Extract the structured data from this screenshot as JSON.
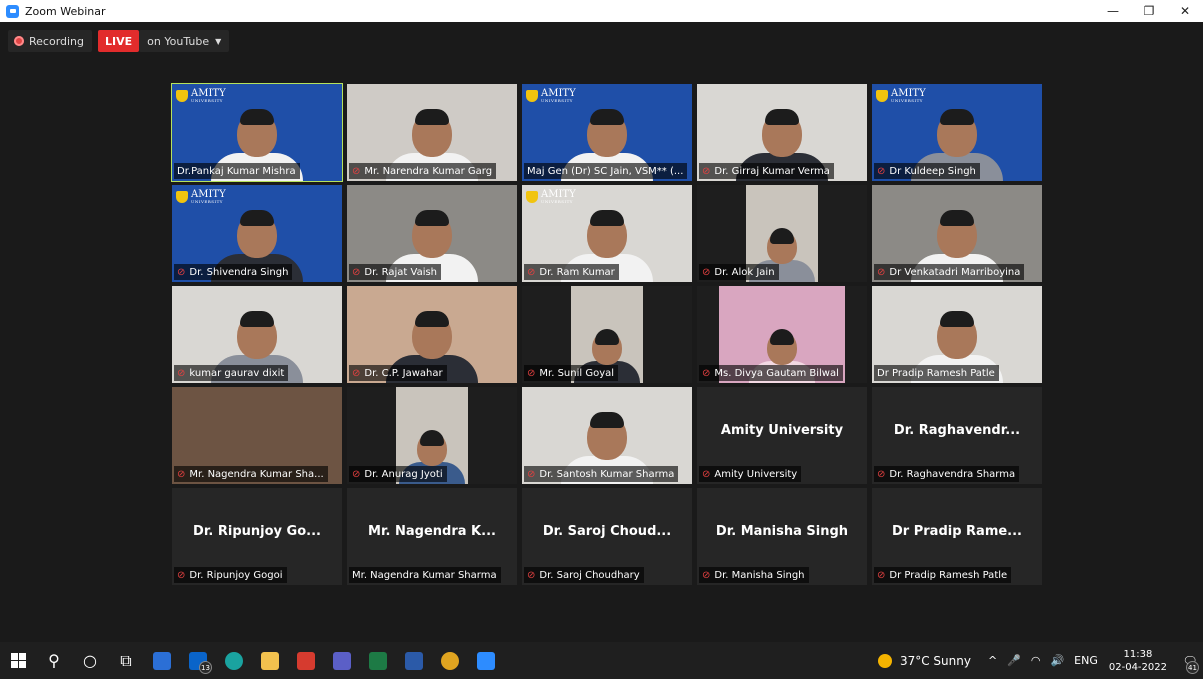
{
  "window": {
    "title": "Zoom Webinar"
  },
  "recbar": {
    "recording": "Recording",
    "live": "LIVE",
    "on_youtube": "on YouTube"
  },
  "tiles": [
    {
      "label": "Dr.Pankaj Kumar Mishra",
      "muted": false,
      "type": "video",
      "bg": "blue",
      "logo": true,
      "active": true,
      "body": "white"
    },
    {
      "label": "Mr.  Narendra Kumar Garg",
      "muted": true,
      "type": "video",
      "bg": "wall",
      "logo": false,
      "body": "white"
    },
    {
      "label": "Maj Gen (Dr) SC Jain, VSM** (...",
      "muted": false,
      "type": "video",
      "bg": "blue",
      "logo": true,
      "body": "white"
    },
    {
      "label": "Dr. Girraj Kumar Verma",
      "muted": true,
      "type": "video",
      "bg": "light",
      "logo": false,
      "body": "suit"
    },
    {
      "label": "Dr Kuldeep Singh",
      "muted": true,
      "type": "video",
      "bg": "blue",
      "logo": true,
      "body": "grey"
    },
    {
      "label": "Dr.  Shivendra Singh",
      "muted": true,
      "type": "video",
      "bg": "blue",
      "logo": true,
      "body": "suit"
    },
    {
      "label": "Dr. Rajat Vaish",
      "muted": true,
      "type": "video",
      "bg": "gray",
      "logo": false,
      "body": "white"
    },
    {
      "label": "Dr. Ram Kumar",
      "muted": true,
      "type": "video",
      "bg": "light",
      "logo": true,
      "body": "white"
    },
    {
      "label": "Dr. Alok Jain",
      "muted": true,
      "type": "inset",
      "bg": "dark",
      "body": "grey"
    },
    {
      "label": "Dr Venkatadri Marriboyina",
      "muted": true,
      "type": "video",
      "bg": "gray",
      "logo": false,
      "body": "white"
    },
    {
      "label": "kumar gaurav dixit",
      "muted": true,
      "type": "video",
      "bg": "light",
      "logo": false,
      "body": "grey"
    },
    {
      "label": "Dr. C.P. Jawahar",
      "muted": true,
      "type": "video",
      "bg": "warm",
      "logo": false,
      "body": "suit"
    },
    {
      "label": "Mr.  Sunil Goyal",
      "muted": true,
      "type": "inset",
      "bg": "dark",
      "body": "suit"
    },
    {
      "label": "Ms. Divya Gautam Bilwal",
      "muted": true,
      "type": "inset",
      "bg": "dark",
      "body": "pink"
    },
    {
      "label": "Dr Pradip Ramesh Patle",
      "muted": false,
      "type": "video",
      "bg": "light",
      "logo": false,
      "body": "white"
    },
    {
      "label": "Mr.  Nagendra Kumar Sha...",
      "muted": true,
      "type": "video",
      "bg": "brown",
      "logo": false,
      "body": "none"
    },
    {
      "label": "Dr.  Anurag Jyoti",
      "muted": true,
      "type": "inset",
      "bg": "dark",
      "body": "blue"
    },
    {
      "label": "Dr. Santosh Kumar Sharma",
      "muted": true,
      "type": "video",
      "bg": "light",
      "logo": false,
      "body": "white"
    },
    {
      "label": "Amity University",
      "muted": true,
      "type": "name",
      "name": "Amity University"
    },
    {
      "label": "Dr. Raghavendra Sharma",
      "muted": true,
      "type": "name",
      "name": "Dr.  Raghavendr..."
    },
    {
      "label": "Dr.  Ripunjoy Gogoi",
      "muted": true,
      "type": "name",
      "name": "Dr.  Ripunjoy Go..."
    },
    {
      "label": "Mr.  Nagendra Kumar Sharma",
      "muted": false,
      "type": "name",
      "name": "Mr.  Nagendra K..."
    },
    {
      "label": "Dr.  Saroj Choudhary",
      "muted": true,
      "type": "name",
      "name": "Dr.  Saroj Choud..."
    },
    {
      "label": "Dr. Manisha Singh",
      "muted": true,
      "type": "name",
      "name": "Dr. Manisha Singh"
    },
    {
      "label": "Dr Pradip Ramesh Patle",
      "muted": true,
      "type": "name",
      "name": "Dr Pradip Rame..."
    }
  ],
  "logo_text": "AMITY",
  "logo_sub": "UNIVERSITY",
  "taskbar": {
    "apps": [
      {
        "name": "start-button",
        "glyph": "windows-logo"
      },
      {
        "name": "search-button",
        "glyph": "search-icon",
        "text": "⚲"
      },
      {
        "name": "cortana-button",
        "glyph": "circle-icon",
        "text": "○"
      },
      {
        "name": "task-view-button",
        "glyph": "task-view-icon",
        "text": "⧉"
      },
      {
        "name": "store-app",
        "glyph": "store-icon",
        "color": "#2b6fd6"
      },
      {
        "name": "mail-app",
        "glyph": "mail-icon",
        "color": "#0a64c9",
        "badge": "13"
      },
      {
        "name": "edge-app",
        "glyph": "edge-icon",
        "color": "#1aa3a0"
      },
      {
        "name": "explorer-app",
        "glyph": "folder-icon",
        "color": "#f2c14e"
      },
      {
        "name": "acrobat-app",
        "glyph": "pdf-icon",
        "color": "#d63b2f"
      },
      {
        "name": "teams-app",
        "glyph": "teams-icon",
        "color": "#5b5fc7"
      },
      {
        "name": "excel-app",
        "glyph": "excel-icon",
        "color": "#1d7a45"
      },
      {
        "name": "word-app",
        "glyph": "word-icon",
        "color": "#2b5aa8"
      },
      {
        "name": "chrome-app",
        "glyph": "chrome-icon",
        "color": "#e0a420"
      },
      {
        "name": "zoom-app",
        "glyph": "zoom-icon",
        "color": "#2d8cff"
      }
    ],
    "weather": "37°C  Sunny",
    "lang": "ENG",
    "time": "11:38",
    "date": "02-04-2022",
    "notifications": "41"
  }
}
